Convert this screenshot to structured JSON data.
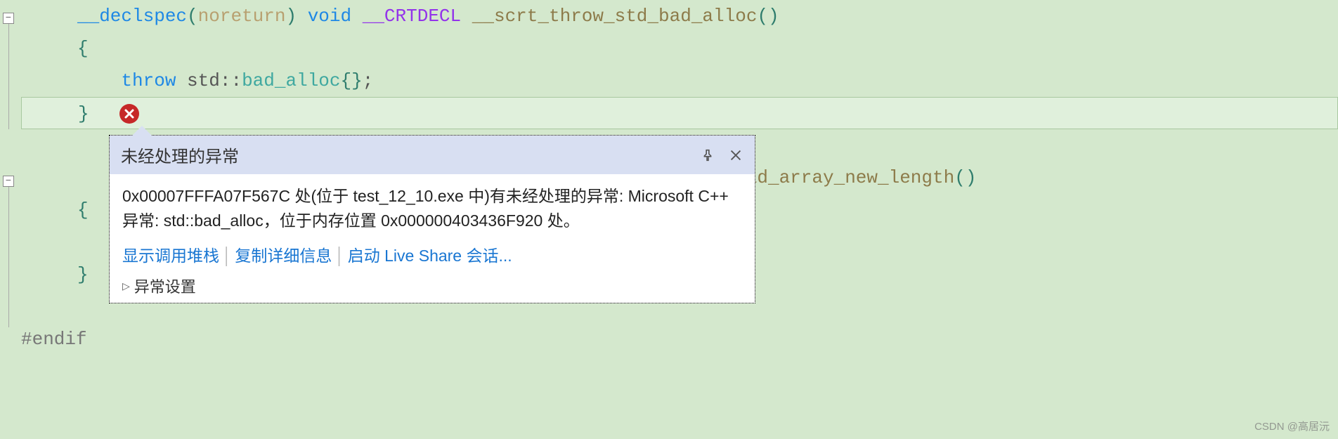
{
  "code": {
    "line1": {
      "declspec": "__declspec",
      "lparen": "(",
      "noreturn": "noreturn",
      "rparen": ")",
      "void": "void",
      "crtdecl": "__CRTDECL",
      "funcname": "__scrt_throw_std_bad_alloc",
      "parens": "()"
    },
    "line2": {
      "brace": "{"
    },
    "line3": {
      "throw": "throw",
      "std": "std",
      "colons": "::",
      "badalloc": "bad_alloc",
      "braces": "{}",
      "semi": ";"
    },
    "line4": {
      "brace": "}"
    },
    "line6": {
      "funcname": "_bad_array_new_length",
      "parens": "()"
    },
    "line7": {
      "brace": "{"
    },
    "line9": {
      "brace": "}"
    },
    "line11": {
      "text": "#endif"
    }
  },
  "icons": {
    "error": "error-icon"
  },
  "popup": {
    "title": "未经处理的异常",
    "body": "0x00007FFFA07F567C 处(位于 test_12_10.exe 中)有未经处理的异常: Microsoft C++ 异常: std::bad_alloc，位于内存位置 0x000000403436F920 处。",
    "links": {
      "callstack": "显示调用堆栈",
      "copy": "复制详细信息",
      "liveshare": "启动 Live Share 会话..."
    },
    "settings": "异常设置"
  },
  "watermark": "CSDN @高居沅"
}
